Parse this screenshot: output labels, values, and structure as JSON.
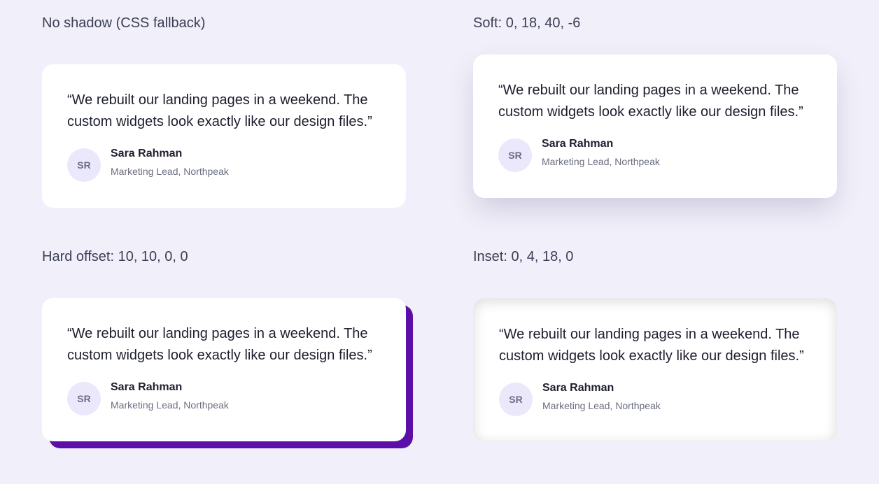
{
  "colors": {
    "background": "#f1eff9",
    "card": "#ffffff",
    "avatar_bg": "#ebe8fb",
    "hard_shadow": "#5b0ea8"
  },
  "panels": [
    {
      "label": "No shadow (CSS fallback)",
      "quote": "“We rebuilt our landing pages in a weekend. The custom widgets look exactly like our design files.”",
      "avatar": "SR",
      "name": "Sara Rahman",
      "role": "Marketing Lead, Northpeak"
    },
    {
      "label": "Soft: 0, 18, 40, -6",
      "quote": "“We rebuilt our landing pages in a weekend. The custom widgets look exactly like our design files.”",
      "avatar": "SR",
      "name": "Sara Rahman",
      "role": "Marketing Lead, Northpeak"
    },
    {
      "label": "Hard offset: 10, 10, 0, 0",
      "quote": "“We rebuilt our landing pages in a weekend. The custom widgets look exactly like our design files.”",
      "avatar": "SR",
      "name": "Sara Rahman",
      "role": "Marketing Lead, Northpeak"
    },
    {
      "label": "Inset: 0, 4, 18, 0",
      "quote": "“We rebuilt our landing pages in a weekend. The custom widgets look exactly like our design files.”",
      "avatar": "SR",
      "name": "Sara Rahman",
      "role": "Marketing Lead, Northpeak"
    }
  ]
}
